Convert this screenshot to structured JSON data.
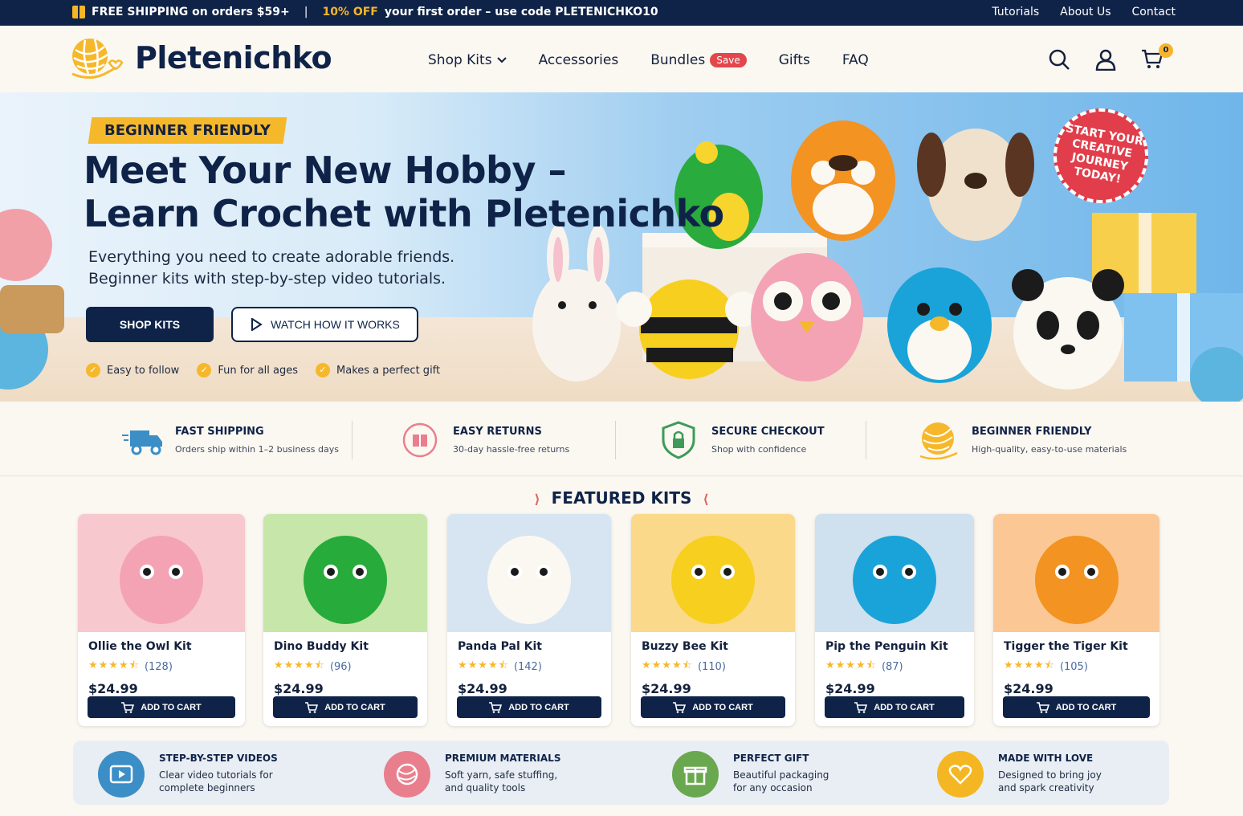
{
  "topbar": {
    "promo_part1": "FREE SHIPPING on orders $59+",
    "separator": "|",
    "promo_highlight": "10% OFF",
    "promo_part2": "your first order – use code PLETENICHKO10",
    "links": [
      "Tutorials",
      "About Us",
      "Contact"
    ],
    "icon": "gift-icon"
  },
  "header": {
    "brand": "Pletenichko",
    "logo_icon": "yarn-ball-heart-icon",
    "nav": [
      {
        "label": "Shop Kits",
        "icon": "chevron-down-icon"
      },
      {
        "label": "Accessories"
      },
      {
        "label": "Bundles",
        "badge": "Save"
      },
      {
        "label": "Gifts"
      },
      {
        "label": "FAQ"
      }
    ],
    "icons": [
      "search-icon",
      "user-icon",
      "cart-icon"
    ],
    "cart_count": "0"
  },
  "hero": {
    "ribbon": "BEGINNER FRIENDLY",
    "title_line1": "Meet Your New Hobby –",
    "title_line2": "Learn Crochet with Pletenichko",
    "subtitle_line1": "Everything you need to create adorable friends.",
    "subtitle_line2": "Beginner kits with step-by-step video tutorials.",
    "primary_cta": "SHOP KITS",
    "secondary_cta": "WATCH HOW IT WORKS",
    "checks": [
      "Easy to follow",
      "Fun for all ages",
      "Makes a perfect gift"
    ],
    "seal_lines": [
      "START YOUR",
      "CREATIVE",
      "JOURNEY",
      "TODAY!"
    ]
  },
  "features": [
    {
      "title": "FAST SHIPPING",
      "subtitle": "Orders ship within 1–2 business days",
      "icon": "truck-icon"
    },
    {
      "title": "EASY RETURNS",
      "subtitle": "30-day hassle-free returns",
      "icon": "return-box-icon"
    },
    {
      "title": "SECURE CHECKOUT",
      "subtitle": "Shop with confidence",
      "icon": "shield-lock-icon"
    },
    {
      "title": "BEGINNER FRIENDLY",
      "subtitle": "High-quality, easy-to-use materials",
      "icon": "yarn-ball-icon"
    }
  ],
  "featured": {
    "title": "FEATURED KITS",
    "add_to_cart": "ADD TO CART",
    "kits": [
      {
        "name": "Ollie the Owl Kit",
        "reviews": "(128)",
        "price": "$24.99",
        "rating": 4.5,
        "bg": "#f7c9cf",
        "body": "#f4a3b5"
      },
      {
        "name": "Dino Buddy Kit",
        "reviews": "(96)",
        "price": "$24.99",
        "rating": 4.5,
        "bg": "#c7e6a9",
        "body": "#27ab3b"
      },
      {
        "name": "Panda Pal Kit",
        "reviews": "(142)",
        "price": "$24.99",
        "rating": 4.5,
        "bg": "#d6e5f1",
        "body": "#fbf8f2"
      },
      {
        "name": "Buzzy Bee Kit",
        "reviews": "(110)",
        "price": "$24.99",
        "rating": 4.5,
        "bg": "#fbd98a",
        "body": "#f7cf1f"
      },
      {
        "name": "Pip the Penguin Kit",
        "reviews": "(87)",
        "price": "$24.99",
        "rating": 4.5,
        "bg": "#cfe0ef",
        "body": "#19a3d9"
      },
      {
        "name": "Tigger the Tiger Kit",
        "reviews": "(105)",
        "price": "$24.99",
        "rating": 4.5,
        "bg": "#fbc895",
        "body": "#f39322"
      }
    ]
  },
  "perks": [
    {
      "title": "STEP-BY-STEP VIDEOS",
      "line1": "Clear video tutorials for",
      "line2": "complete beginners",
      "icon": "video-play-icon",
      "color": "#3b8ec6"
    },
    {
      "title": "PREMIUM MATERIALS",
      "line1": "Soft yarn, safe stuffing,",
      "line2": "and quality tools",
      "icon": "yarn-ball-icon",
      "color": "#e97f8d"
    },
    {
      "title": "PERFECT GIFT",
      "line1": "Beautiful packaging",
      "line2": "for any occasion",
      "icon": "gift-icon",
      "color": "#6aa84f"
    },
    {
      "title": "MADE WITH LOVE",
      "line1": "Designed to bring joy",
      "line2": "and spark creativity",
      "icon": "heart-icon",
      "color": "#f4b723"
    }
  ],
  "colors": {
    "navy": "#0f2348",
    "accent_yellow": "#f6b82b",
    "sale_red": "#e2474b"
  }
}
